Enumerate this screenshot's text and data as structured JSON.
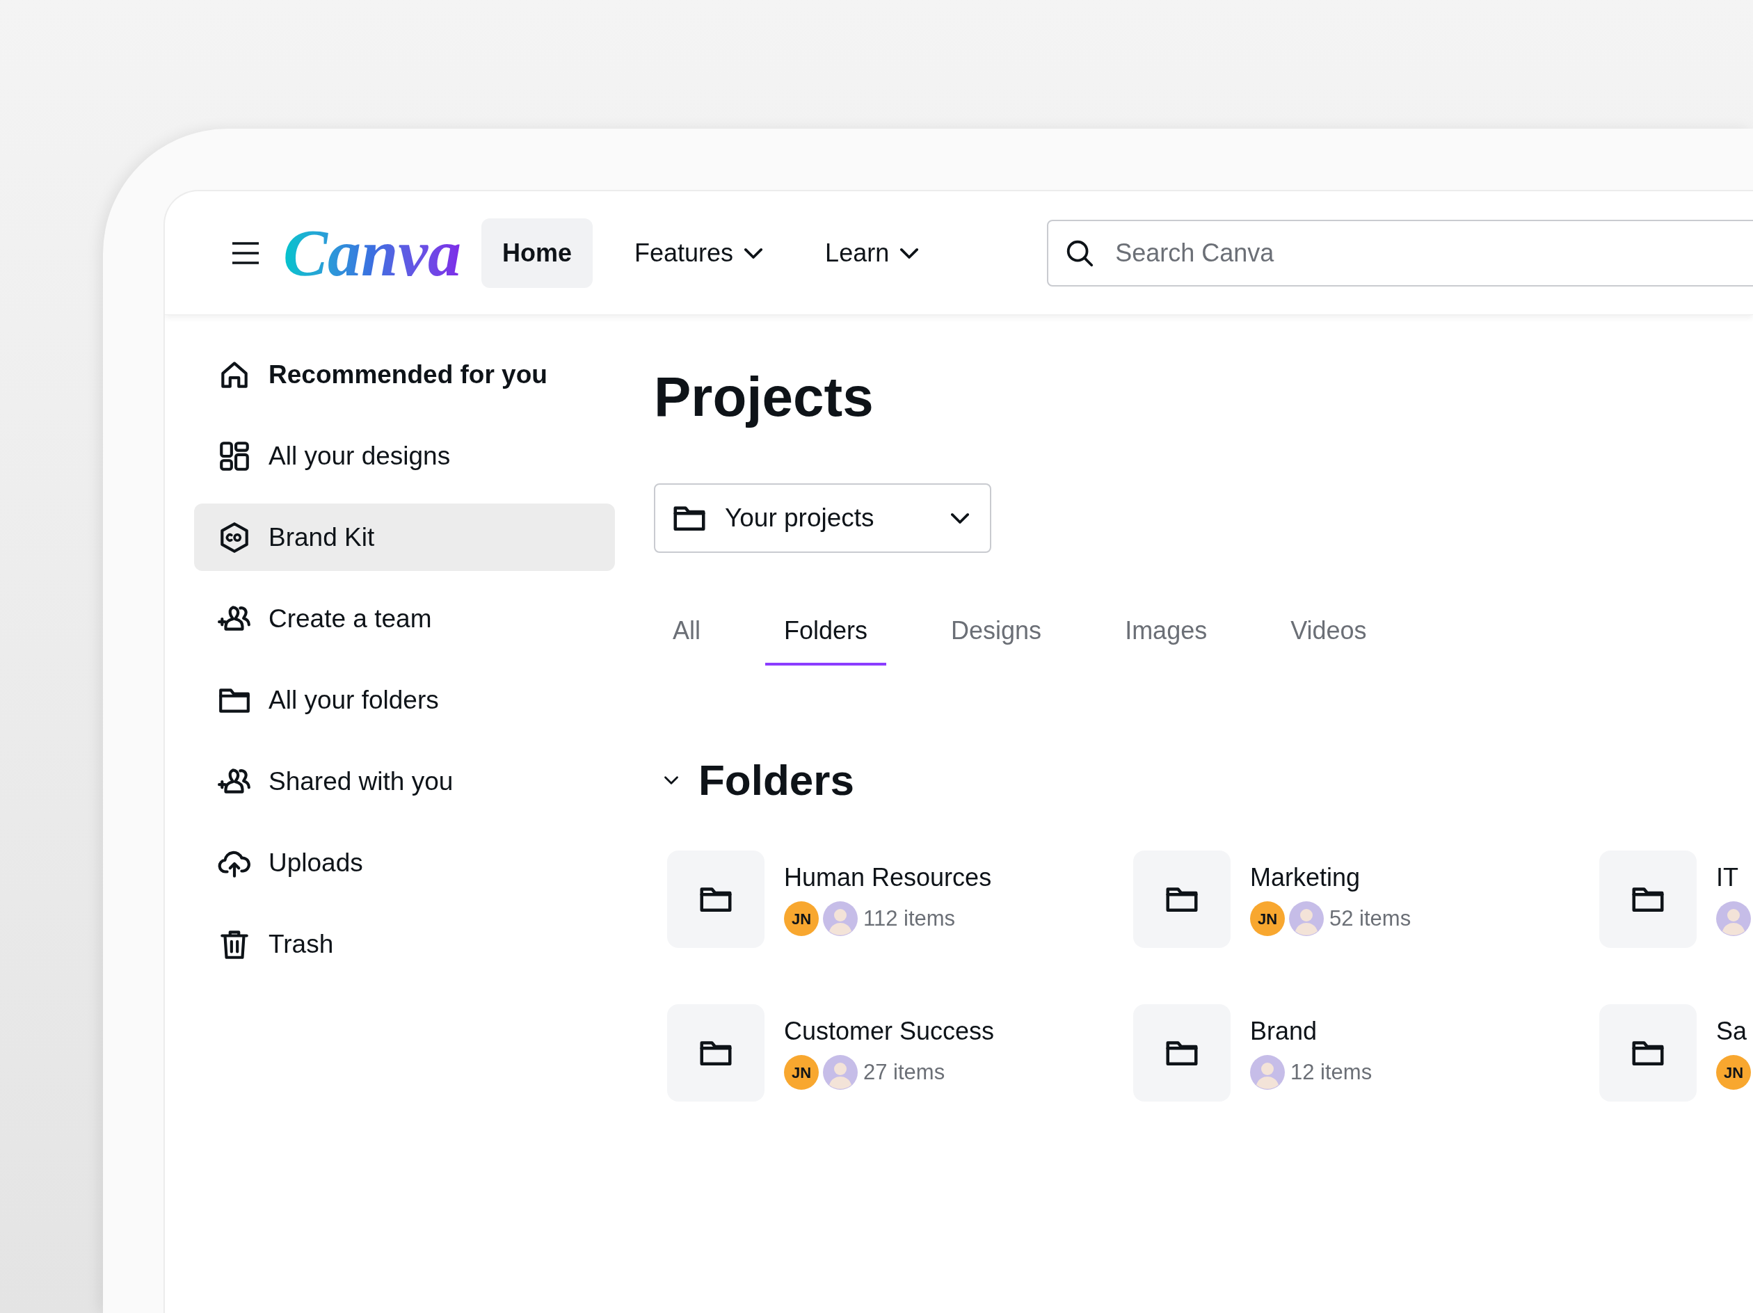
{
  "header": {
    "logo": "Canva",
    "nav": [
      {
        "label": "Home",
        "selected": true,
        "dropdown": false
      },
      {
        "label": "Features",
        "selected": false,
        "dropdown": true
      },
      {
        "label": "Learn",
        "selected": false,
        "dropdown": true
      }
    ],
    "search": {
      "placeholder": "Search Canva"
    }
  },
  "sidebar": {
    "items": [
      {
        "label": "Recommended for you",
        "bold": true,
        "selected": false
      },
      {
        "label": "All your designs",
        "bold": false,
        "selected": false
      },
      {
        "label": "Brand Kit",
        "bold": false,
        "selected": true
      },
      {
        "label": "Create a team",
        "bold": false,
        "selected": false
      },
      {
        "label": "All your folders",
        "bold": false,
        "selected": false
      },
      {
        "label": "Shared with you",
        "bold": false,
        "selected": false
      },
      {
        "label": "Uploads",
        "bold": false,
        "selected": false
      },
      {
        "label": "Trash",
        "bold": false,
        "selected": false
      }
    ]
  },
  "main": {
    "title": "Projects",
    "project_select": "Your projects",
    "tabs": [
      {
        "label": "All",
        "selected": false
      },
      {
        "label": "Folders",
        "selected": true
      },
      {
        "label": "Designs",
        "selected": false
      },
      {
        "label": "Images",
        "selected": false
      },
      {
        "label": "Videos",
        "selected": false
      }
    ],
    "section": {
      "title": "Folders",
      "expanded": true,
      "folders": [
        {
          "name": "Human Resources",
          "avatars": [
            {
              "kind": "initials",
              "initials": "JN"
            },
            {
              "kind": "photo"
            }
          ],
          "count": "112 items"
        },
        {
          "name": "Marketing",
          "avatars": [
            {
              "kind": "initials",
              "initials": "JN"
            },
            {
              "kind": "photo"
            }
          ],
          "count": "52 items"
        },
        {
          "name": "IT",
          "avatars": [
            {
              "kind": "photo"
            }
          ]
        },
        {
          "name": "Customer Success",
          "avatars": [
            {
              "kind": "initials",
              "initials": "JN"
            },
            {
              "kind": "photo"
            }
          ],
          "count": "27 items"
        },
        {
          "name": "Brand",
          "avatars": [
            {
              "kind": "photo"
            }
          ],
          "count": "12 items"
        },
        {
          "name": "Sa",
          "avatars": [
            {
              "kind": "initials",
              "initials": "JN"
            }
          ]
        }
      ]
    }
  }
}
